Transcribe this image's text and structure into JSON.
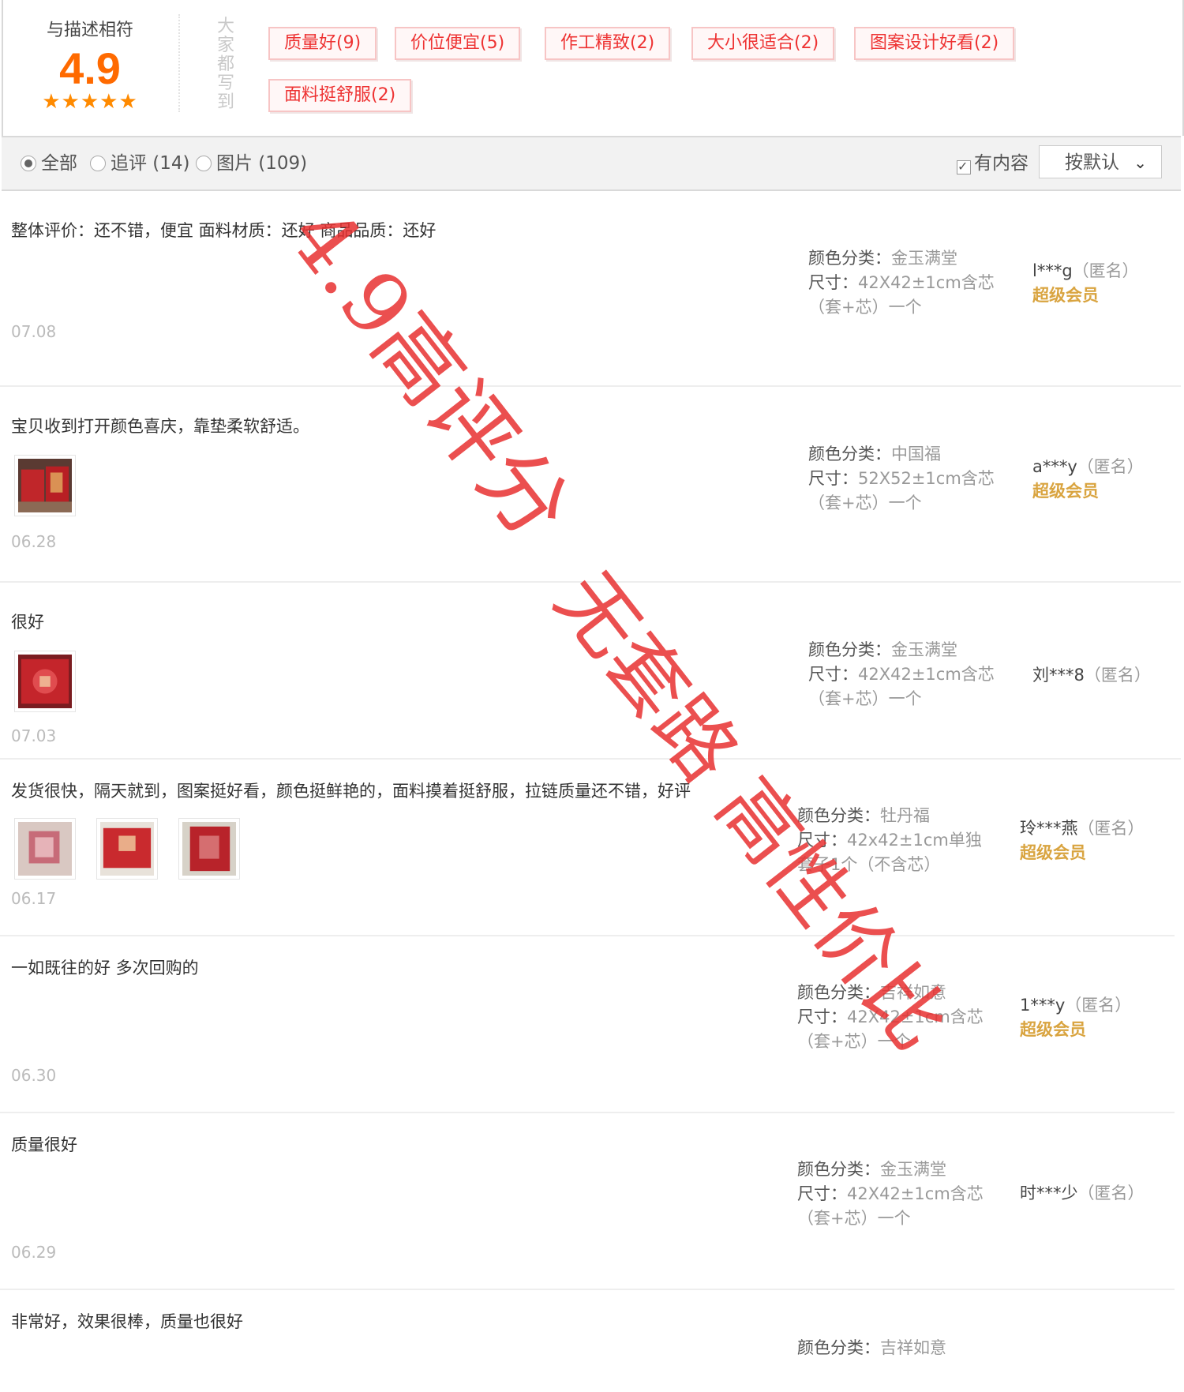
{
  "summary": {
    "score_label": "与描述相符",
    "score": "4.9",
    "stars": "★★★★★",
    "hint": "大家都写到",
    "tags": [
      "质量好(9)",
      "价位便宜(5)",
      "作工精致(2)",
      "大小很适合(2)",
      "图案设计好看(2)",
      "面料挺舒服(2)"
    ]
  },
  "filters": {
    "all": "全部",
    "followup": "追评 (14)",
    "pictures": "图片 (109)",
    "has_content": "有内容",
    "sort": "按默认"
  },
  "sku_labels": {
    "color": "颜色分类：",
    "size": "尺寸："
  },
  "anon_label": "（匿名）",
  "reviews": [
    {
      "text": "整体评价：还不错，便宜 面料材质：还好 商品品质：还好",
      "date": "07.08",
      "color": "金玉满堂",
      "size": "42X42±1cm含芯",
      "size2": "（套+芯）一个",
      "user": "l***g",
      "vip": "超级会员"
    },
    {
      "text": "宝贝收到打开颜色喜庆，靠垫柔软舒适。",
      "date": "06.28",
      "color": "中国福",
      "size": "52X52±1cm含芯",
      "size2": "（套+芯）一个",
      "user": "a***y",
      "vip": "超级会员"
    },
    {
      "text": "很好",
      "date": "07.03",
      "color": "金玉满堂",
      "size": "42X42±1cm含芯",
      "size2": "（套+芯）一个",
      "user": "刘***8",
      "vip": ""
    },
    {
      "text": "发货很快，隔天就到，图案挺好看，颜色挺鲜艳的，面料摸着挺舒服，拉链质量还不错，好评",
      "date": "06.17",
      "color": "牡丹福",
      "size": "42x42±1cm单独",
      "size2": "套子1个（不含芯）",
      "user": "玲***燕",
      "vip": "超级会员"
    },
    {
      "text": "一如既往的好 多次回购的",
      "date": "06.30",
      "color": "吉祥如意",
      "size": "42X42±1cm含芯",
      "size2": "（套+芯）一个",
      "user": "1***y",
      "vip": "超级会员"
    },
    {
      "text": "质量很好",
      "date": "06.29",
      "color": "金玉满堂",
      "size": "42X42±1cm含芯",
      "size2": "（套+芯）一个",
      "user": "时***少",
      "vip": ""
    },
    {
      "text": "非常好，效果很棒，质量也很好",
      "date": "",
      "color": "吉祥如意",
      "size": "",
      "size2": "",
      "user": "",
      "vip": ""
    }
  ],
  "watermark": {
    "line1": "4.9高评分",
    "line2": "无套路 高性价比",
    "color": "#e83030"
  },
  "colors": {
    "accent": "#ff6a00",
    "tag_text": "#ee3333",
    "vip": "#d9a440"
  }
}
